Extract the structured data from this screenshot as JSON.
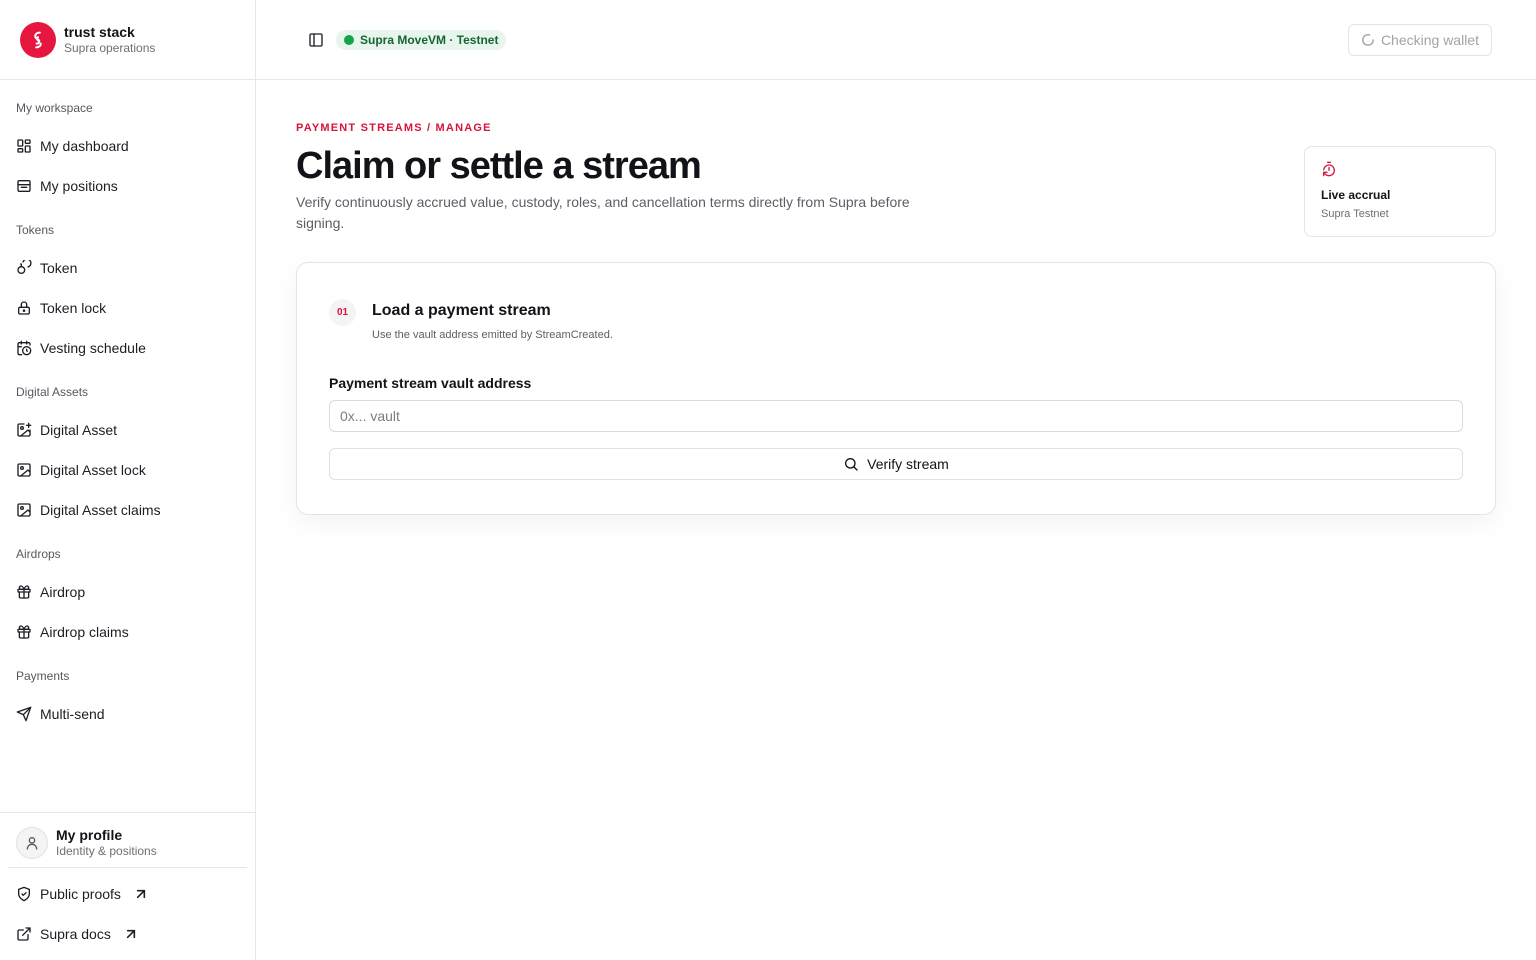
{
  "brand": {
    "name": "trust stack",
    "subtitle": "Supra operations"
  },
  "sidebar": {
    "groups": [
      {
        "label": "My workspace",
        "items": [
          {
            "label": "My dashboard",
            "icon": "dashboard-icon"
          },
          {
            "label": "My positions",
            "icon": "positions-icon"
          }
        ]
      },
      {
        "label": "Tokens",
        "items": [
          {
            "label": "Token",
            "icon": "coins-icon"
          },
          {
            "label": "Token lock",
            "icon": "lock-icon"
          },
          {
            "label": "Vesting schedule",
            "icon": "calendar-clock-icon"
          }
        ]
      },
      {
        "label": "Digital Assets",
        "items": [
          {
            "label": "Digital Asset",
            "icon": "image-plus-icon"
          },
          {
            "label": "Digital Asset lock",
            "icon": "image-icon"
          },
          {
            "label": "Digital Asset claims",
            "icon": "image-icon"
          }
        ]
      },
      {
        "label": "Airdrops",
        "items": [
          {
            "label": "Airdrop",
            "icon": "gift-icon"
          },
          {
            "label": "Airdrop claims",
            "icon": "gift-icon"
          }
        ]
      },
      {
        "label": "Payments",
        "items": [
          {
            "label": "Multi-send",
            "icon": "send-icon"
          }
        ]
      }
    ],
    "profile": {
      "name": "My profile",
      "subtitle": "Identity & positions"
    },
    "footer_links": [
      {
        "label": "Public proofs",
        "icon": "shield-check-icon"
      },
      {
        "label": "Supra docs",
        "icon": "external-link-icon"
      }
    ]
  },
  "topbar": {
    "network": "Supra MoveVM · Testnet",
    "wallet_status": "Checking wallet"
  },
  "page": {
    "eyebrow": "PAYMENT STREAMS / MANAGE",
    "title": "Claim or settle a stream",
    "description": "Verify continuously accrued value, custody, roles, and cancellation terms directly from Supra before signing."
  },
  "accrual": {
    "title": "Live accrual",
    "subtitle": "Supra Testnet"
  },
  "step": {
    "number": "01",
    "title": "Load a payment stream",
    "subtitle": "Use the vault address emitted by StreamCreated.",
    "field_label": "Payment stream vault address",
    "field_placeholder": "0x... vault",
    "field_value": "",
    "button_label": "Verify stream"
  },
  "colors": {
    "accent": "#d6143c",
    "brand": "#e5173f",
    "network_bg": "#e8f5ec",
    "network_text": "#166534",
    "network_dot": "#16a34a"
  }
}
